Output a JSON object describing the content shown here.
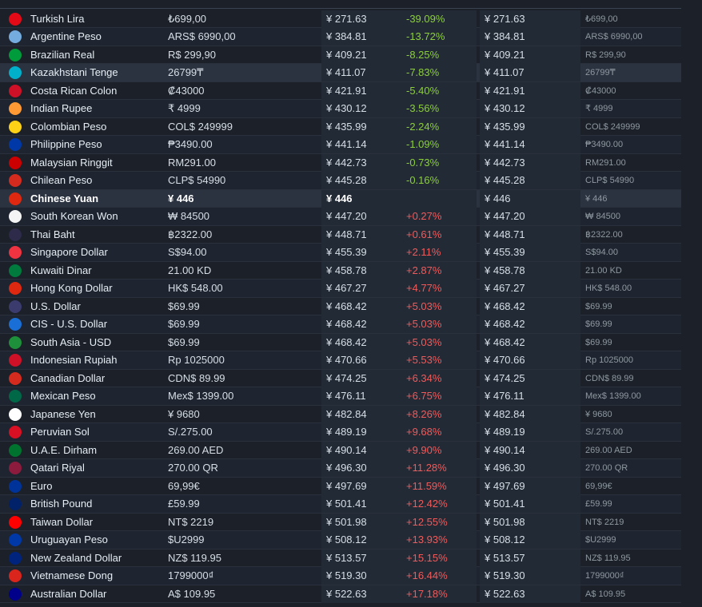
{
  "rows": [
    {
      "name": "Turkish Lira",
      "price": "₺699,00",
      "cny": "¥ 271.63",
      "diff": "-39.09%",
      "flag": "#e30a17"
    },
    {
      "name": "Argentine Peso",
      "price": "ARS$ 6990,00",
      "cny": "¥ 384.81",
      "diff": "-13.72%",
      "flag": "#74acdf"
    },
    {
      "name": "Brazilian Real",
      "price": "R$ 299,90",
      "cny": "¥ 409.21",
      "diff": "-8.25%",
      "flag": "#009b3a"
    },
    {
      "name": "Kazakhstani Tenge",
      "price": "26799₸",
      "cny": "¥ 411.07",
      "diff": "-7.83%",
      "flag": "#00afca"
    },
    {
      "name": "Costa Rican Colon",
      "price": "₡43000",
      "cny": "¥ 421.91",
      "diff": "-5.40%",
      "flag": "#ce1126"
    },
    {
      "name": "Indian Rupee",
      "price": "₹ 4999",
      "cny": "¥ 430.12",
      "diff": "-3.56%",
      "flag": "#ff9933"
    },
    {
      "name": "Colombian Peso",
      "price": "COL$ 249999",
      "cny": "¥ 435.99",
      "diff": "-2.24%",
      "flag": "#fcd116"
    },
    {
      "name": "Philippine Peso",
      "price": "₱3490.00",
      "cny": "¥ 441.14",
      "diff": "-1.09%",
      "flag": "#0038a8"
    },
    {
      "name": "Malaysian Ringgit",
      "price": "RM291.00",
      "cny": "¥ 442.73",
      "diff": "-0.73%",
      "flag": "#cc0001"
    },
    {
      "name": "Chilean Peso",
      "price": "CLP$ 54990",
      "cny": "¥ 445.28",
      "diff": "-0.16%",
      "flag": "#d52b1e"
    },
    {
      "name": "Chinese Yuan",
      "price": "¥ 446",
      "cny": "¥ 446",
      "diff": "",
      "flag": "#de2910"
    },
    {
      "name": "South Korean Won",
      "price": "₩ 84500",
      "cny": "¥ 447.20",
      "diff": "+0.27%",
      "flag": "#f4f4f4"
    },
    {
      "name": "Thai Baht",
      "price": "฿2322.00",
      "cny": "¥ 448.71",
      "diff": "+0.61%",
      "flag": "#2d2a4a"
    },
    {
      "name": "Singapore Dollar",
      "price": "S$94.00",
      "cny": "¥ 455.39",
      "diff": "+2.11%",
      "flag": "#ef3340"
    },
    {
      "name": "Kuwaiti Dinar",
      "price": "21.00 KD",
      "cny": "¥ 458.78",
      "diff": "+2.87%",
      "flag": "#007a3d"
    },
    {
      "name": "Hong Kong Dollar",
      "price": "HK$ 548.00",
      "cny": "¥ 467.27",
      "diff": "+4.77%",
      "flag": "#de2910"
    },
    {
      "name": "U.S. Dollar",
      "price": "$69.99",
      "cny": "¥ 468.42",
      "diff": "+5.03%",
      "flag": "#3c3b6e"
    },
    {
      "name": "CIS - U.S. Dollar",
      "price": "$69.99",
      "cny": "¥ 468.42",
      "diff": "+5.03%",
      "flag": "#1a6fd6"
    },
    {
      "name": "South Asia - USD",
      "price": "$69.99",
      "cny": "¥ 468.42",
      "diff": "+5.03%",
      "flag": "#1e8f3a"
    },
    {
      "name": "Indonesian Rupiah",
      "price": "Rp 1025000",
      "cny": "¥ 470.66",
      "diff": "+5.53%",
      "flag": "#ce1126"
    },
    {
      "name": "Canadian Dollar",
      "price": "CDN$ 89.99",
      "cny": "¥ 474.25",
      "diff": "+6.34%",
      "flag": "#d52b1e"
    },
    {
      "name": "Mexican Peso",
      "price": "Mex$ 1399.00",
      "cny": "¥ 476.11",
      "diff": "+6.75%",
      "flag": "#006847"
    },
    {
      "name": "Japanese Yen",
      "price": "¥ 9680",
      "cny": "¥ 482.84",
      "diff": "+8.26%",
      "flag": "#ffffff"
    },
    {
      "name": "Peruvian Sol",
      "price": "S/.275.00",
      "cny": "¥ 489.19",
      "diff": "+9.68%",
      "flag": "#d91023"
    },
    {
      "name": "U.A.E. Dirham",
      "price": "269.00 AED",
      "cny": "¥ 490.14",
      "diff": "+9.90%",
      "flag": "#00732f"
    },
    {
      "name": "Qatari Riyal",
      "price": "270.00 QR",
      "cny": "¥ 496.30",
      "diff": "+11.28%",
      "flag": "#8d1b3d"
    },
    {
      "name": "Euro",
      "price": "69,99€",
      "cny": "¥ 497.69",
      "diff": "+11.59%",
      "flag": "#003399"
    },
    {
      "name": "British Pound",
      "price": "£59.99",
      "cny": "¥ 501.41",
      "diff": "+12.42%",
      "flag": "#012169"
    },
    {
      "name": "Taiwan Dollar",
      "price": "NT$ 2219",
      "cny": "¥ 501.98",
      "diff": "+12.55%",
      "flag": "#fe0000"
    },
    {
      "name": "Uruguayan Peso",
      "price": "$U2999",
      "cny": "¥ 508.12",
      "diff": "+13.93%",
      "flag": "#0038a8"
    },
    {
      "name": "New Zealand Dollar",
      "price": "NZ$ 119.95",
      "cny": "¥ 513.57",
      "diff": "+15.15%",
      "flag": "#00247d"
    },
    {
      "name": "Vietnamese Dong",
      "price": "1799000₫",
      "cny": "¥ 519.30",
      "diff": "+16.44%",
      "flag": "#da251d"
    },
    {
      "name": "Australian Dollar",
      "price": "A$ 109.95",
      "cny": "¥ 522.63",
      "diff": "+17.18%",
      "flag": "#00008b"
    }
  ]
}
